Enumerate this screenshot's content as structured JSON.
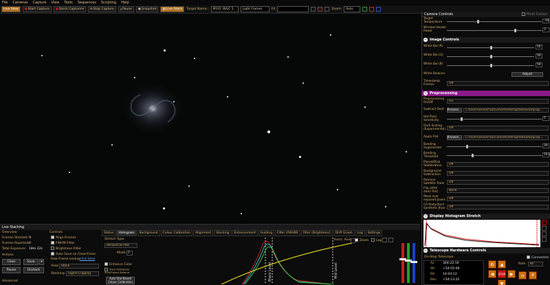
{
  "menu": [
    "File",
    "Cameras",
    "Capture",
    "View",
    "Tools",
    "Sequences",
    "Scripting",
    "Help"
  ],
  "toolbar": {
    "live_view": "Live View",
    "start_capture": "Start Capture",
    "quick_capture": "Quick Capture",
    "stop_capture": "Stop Capture",
    "pause": "Pause",
    "snapshot": "Snapshot",
    "live_stack": "Live Stack",
    "target_name_label": "Target Name :",
    "target_name_value": "M101 (NGC 5…",
    "frame_type": "Light Frames",
    "fx_label": "FX",
    "zoom_label": "Zoom:",
    "zoom_value": "Auto"
  },
  "colors": {
    "accent": "#b07020",
    "preprocessing": "#8a1a8a",
    "stop": "#d01010",
    "control": "#d07010"
  },
  "right_panel": {
    "camera_controls": "Camera Controls",
    "multi_colour": "Multi Colour",
    "target_temperature_label": "Target Temperature",
    "target_temperature_value": "-10.0",
    "window_heater_label": "Window Heater Power",
    "window_heater_value": "3",
    "image_controls": "Image Controls",
    "white_bal_r": "White Bal (R)",
    "white_bal_g": "White Bal (G)",
    "white_bal_b": "White Bal (B)",
    "wb_r_value": "50",
    "wb_g_value": "50",
    "wb_b_value": "50",
    "white_balance_label": "White Balance",
    "adjust": "Adjust",
    "timestamp_label": "Timestamp Frames",
    "timestamp_value": "Off",
    "preprocessing": "Preprocessing",
    "preproc_onoff_label": "Preprocessing On/Off",
    "preproc_onoff_value": "On",
    "subtract_dark_label": "Subtract Dark",
    "browse": "Browse...",
    "dark_path": "C:\\Users\\Olivier\\Documents\\Astrophoto\\Sharpcap...",
    "hot_pixel_label": "Hot Pixel Sensitivity",
    "hot_pixel_value": "5",
    "dark_scaling_label": "Dark Scaling (Experimental)",
    "dark_scaling_value": "Off",
    "apply_flat_label": "Apply Flat",
    "flat_path": "C:\\Users\\Olivier\\Documents\\Astrophoto\\Sharpcap...",
    "banding_supp_label": "Banding Suppression",
    "banding_supp_value": "20",
    "banding_thresh_label": "Banding Threshold",
    "banding_thresh_value": "10.0",
    "planet_disk_label": "Planet/Disk Stabilization",
    "planet_disk_value": "Off",
    "bg_sub_label": "Background Subtraction",
    "bg_sub_value": "Off",
    "remove_sat_label": "Remove Satellite Trails",
    "remove_sat_value": "Off",
    "flip_label": "Flip (after dark/ flat)",
    "flip_value": "None",
    "mask_label": "Mask over exposed pixels",
    "mask_value": "Off",
    "ca_label": "CA Reduction/ Synthetic Blue",
    "ca_value": "Off",
    "display_histogram": "Display Histogram Stretch",
    "telescope_controls": "Telescope Hardware Controls",
    "onstep": "On-Step Telescope",
    "connected": "Connected",
    "az_label": "Az",
    "az_value": "304:22:10",
    "alt_label": "Alt",
    "alt_value": "+54:55:09",
    "ra_label": "RA",
    "ra_value": "14:04:12",
    "dec_label": "Dec",
    "dec_value": "+54:13:22",
    "rate_label": "Rate",
    "rate_value": "8x",
    "stop": "STOP"
  },
  "live_stacking": {
    "title": "Live Stacking",
    "overview": "Overview",
    "frames_stacked_label": "Frames Stacked:",
    "frames_stacked_value": "9",
    "frames_rejected_label": "Frames Rejected:",
    "frames_rejected_value": "0",
    "total_exposure_label": "Total Exposure:",
    "total_exposure_value": "18m 22s",
    "actions": "Actions",
    "clear": "Clear",
    "save": "Save",
    "pause": "Pause",
    "unstack": "Unstack",
    "advanced": "Advanced",
    "controls": "Controls",
    "align_frames": "Align Frames",
    "fwhm_filter": "FWHM Filter",
    "brightness_filter": "Brightness Filter",
    "auto_save": "Auto Save on Clear/Close",
    "raw_frame_saving": "Raw Frame saving:",
    "click_here": "click here",
    "view_label": "View",
    "view_value": "Stack",
    "stacking_label": "Stacking",
    "stacking_value": "Sigma Clipping",
    "tabs": [
      "Status",
      "Histogram",
      "Background",
      "Colour Calibration",
      "Alignment",
      "Stacking",
      "Enhancement",
      "Guiding",
      "Filter (FWHM)",
      "Filter (Brightness)",
      "Drift Graph",
      "Log",
      "Settings"
    ],
    "stretch_type": "Stretch Type",
    "stretch_value": "Reciprocal Pow",
    "mode_label": "Mode",
    "mode_value": "2",
    "enhance_color": "Enhance Color",
    "track_histogram": "Track Histogram Shift/Colour Balance",
    "auto_star_based": "Auto Star-Based Colour Calibration",
    "horiz_axis": "Horiz. Axis:",
    "zoom": "Zoom",
    "log": "Log"
  }
}
